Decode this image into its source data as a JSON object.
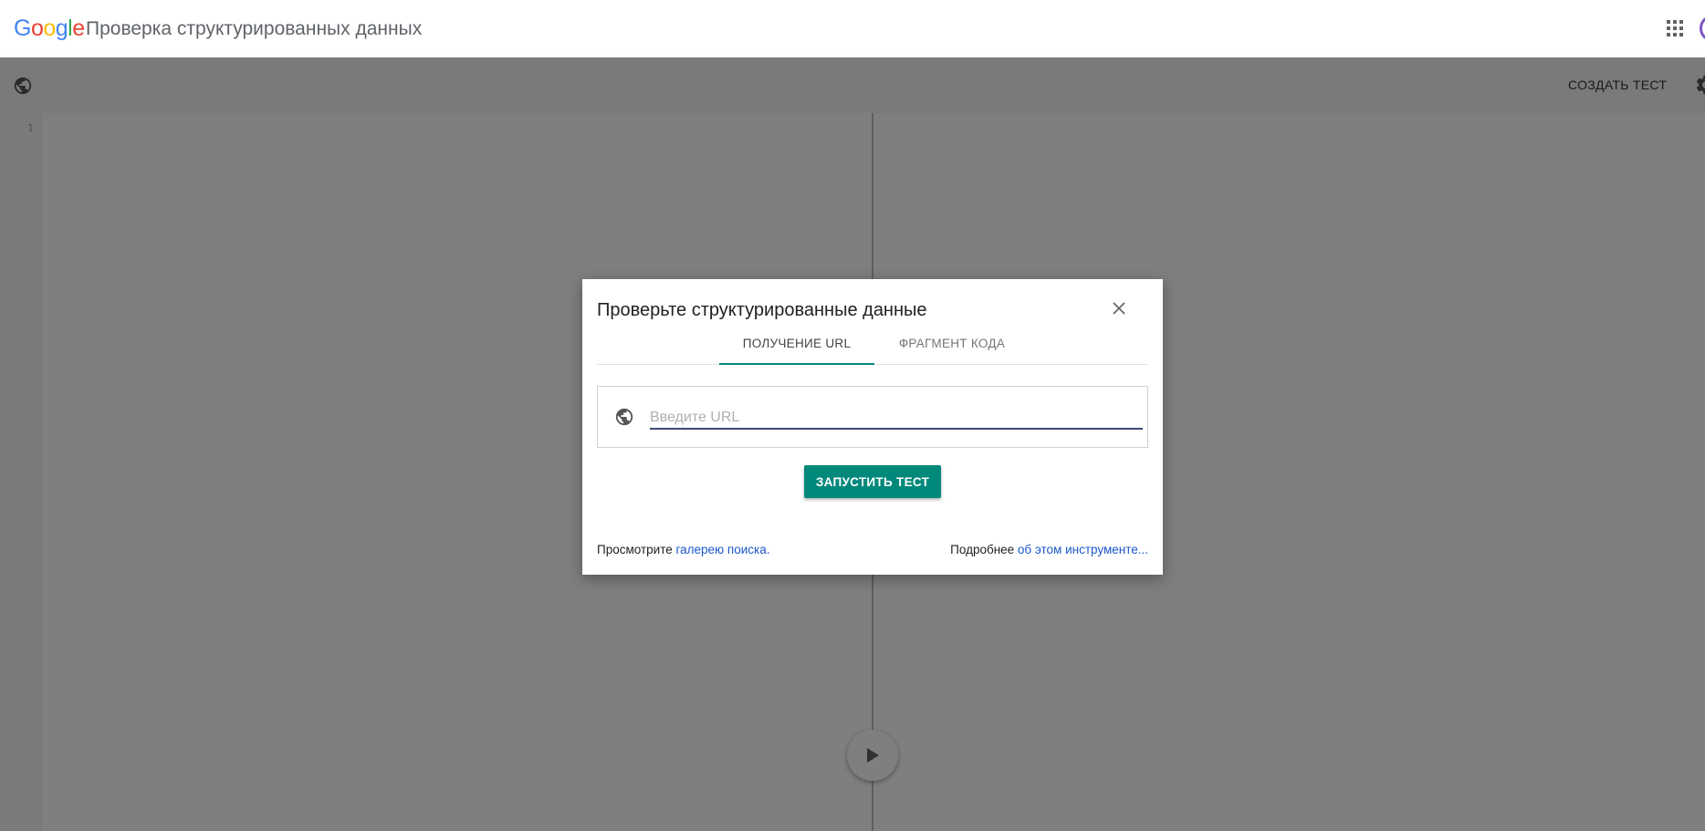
{
  "header": {
    "logo_letters": [
      "G",
      "o",
      "o",
      "g",
      "l",
      "e"
    ],
    "title": "Проверка структурированных данных"
  },
  "toolbar": {
    "create_test_label": "СОЗДАТЬ ТЕСТ"
  },
  "editor": {
    "line_numbers": [
      "1"
    ]
  },
  "dialog": {
    "title": "Проверьте структурированные данные",
    "tabs": [
      {
        "label": "ПОЛУЧЕНИЕ URL",
        "active": true
      },
      {
        "label": "ФРАГМЕНТ КОДА",
        "active": false
      }
    ],
    "url_input": {
      "value": "",
      "placeholder": "Введите URL"
    },
    "run_button_label": "ЗАПУСТИТЬ ТЕСТ",
    "footer_left": {
      "prefix": "Просмотрите ",
      "link": "галерею поиска."
    },
    "footer_right": {
      "prefix": "Подробнее ",
      "link": "об этом инструменте..."
    }
  },
  "icons": {
    "apps": "apps-grid-icon",
    "toolbar_globe": "globe-icon",
    "settings": "gear-icon",
    "close": "close-icon",
    "url_globe": "globe-icon",
    "run": "play-icon"
  },
  "colors": {
    "accent": "#00897b",
    "link": "#1a57c8",
    "input_underline": "#3c4a72",
    "overlay": "rgba(0,0,0,0.5)"
  }
}
